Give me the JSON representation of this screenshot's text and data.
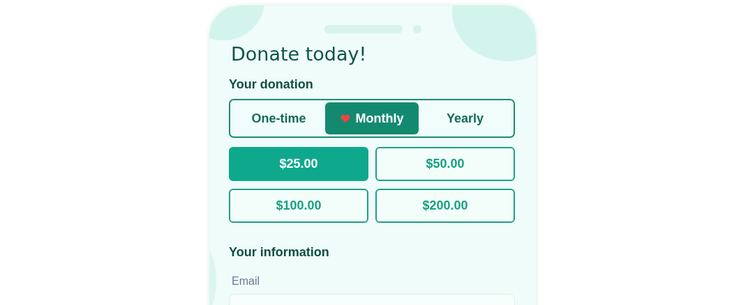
{
  "title": "Donate today!",
  "donation": {
    "heading": "Your donation",
    "frequencies": [
      {
        "label": "One-time",
        "selected": false
      },
      {
        "label": "Monthly",
        "selected": true
      },
      {
        "label": "Yearly",
        "selected": false
      }
    ],
    "amounts": [
      {
        "label": "$25.00",
        "selected": true
      },
      {
        "label": "$50.00",
        "selected": false
      },
      {
        "label": "$100.00",
        "selected": false
      },
      {
        "label": "$200.00",
        "selected": false
      }
    ]
  },
  "information": {
    "heading": "Your information",
    "fields": [
      {
        "label": "Email"
      }
    ]
  }
}
